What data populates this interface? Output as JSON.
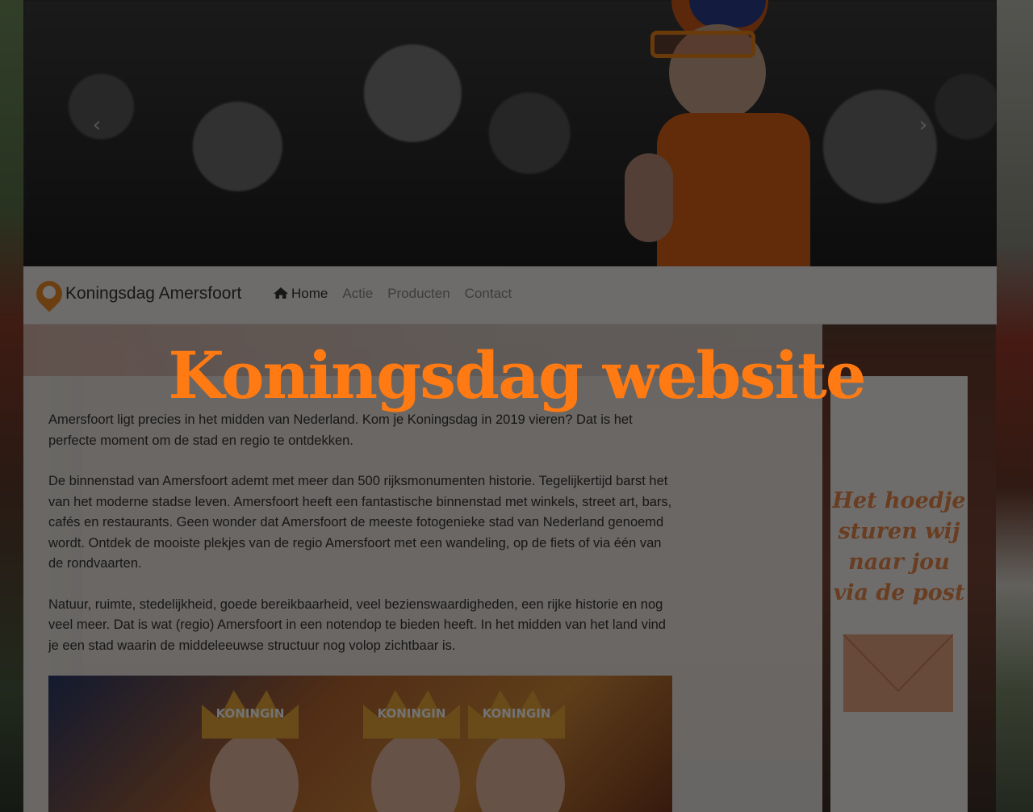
{
  "header": {
    "brand": "Koningsdag Amersfoort",
    "nav": [
      {
        "label": "Home",
        "active": true
      },
      {
        "label": "Actie",
        "active": false
      },
      {
        "label": "Producten",
        "active": false
      },
      {
        "label": "Contact",
        "active": false
      }
    ]
  },
  "overlay_title": "Koningsdag website",
  "content": {
    "paragraphs": [
      "Amersfoort ligt precies in het midden van Nederland. Kom je Koningsdag in 2019 vieren? Dat is het perfecte moment om de stad en regio te ontdekken.",
      "De binnenstad van Amersfoort ademt met meer dan 500 rijksmonumenten historie. Tegelijkertijd barst het van het moderne stadse leven. Amersfoort heeft een fantastische binnenstad met winkels, street art, bars, cafés en restaurants. Geen wonder dat Amersfoort de meeste fotogenieke stad van Nederland genoemd wordt. Ontdek de mooiste plekjes van de regio Amersfoort met een wandeling, op de fiets of via één van de rondvaarten.",
      "Natuur, ruimte, stedelijkheid, goede bereikbaarheid, veel bezienswaardigheden, een rijke historie en nog veel meer. Dat is wat (regio) Amersfoort in een notendop te bieden heeft. In het midden van het land vind je een stad waarin de middeleeuwse structuur nog volop zichtbaar is."
    ],
    "photo_crowns": [
      "KONINGIN",
      "KONINGIN",
      "KONINGIN"
    ]
  },
  "sidebar": {
    "text": "Het hoedje sturen wij naar jou via de post"
  },
  "colors": {
    "accent": "#ff7a12",
    "nav_active": "#333333",
    "nav_inactive": "#888888"
  }
}
